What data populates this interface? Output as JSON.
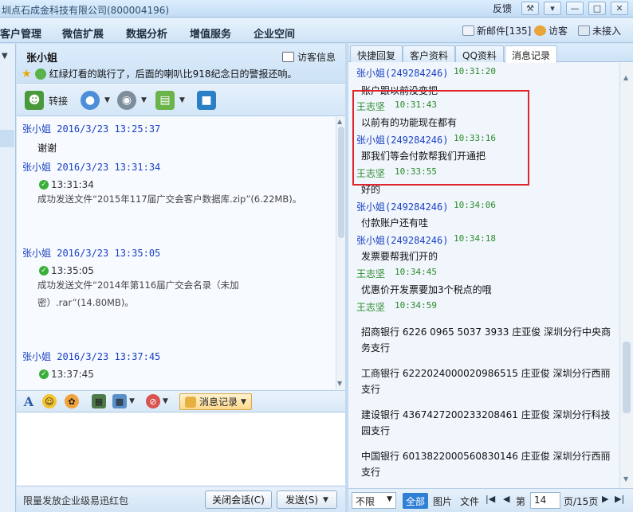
{
  "window": {
    "title": "圳点石成金科技有限公司(800004196)",
    "feedback": "反馈",
    "controls": [
      "wrench-icon",
      "dropdown-icon",
      "minimize-icon",
      "maximize-icon",
      "close-icon"
    ]
  },
  "menubar": {
    "items": [
      "客户管理",
      "微信扩展",
      "数据分析",
      "增值服务",
      "企业空间"
    ],
    "new_mail": "新邮件[135]",
    "visitor": "访客",
    "not_connected": "未接入"
  },
  "chat": {
    "contact_name": "张小姐",
    "visitor_info": "访客信息",
    "status_text": "红绿灯看的跳行了，后面的喇叭比918纪念日的警报还响。",
    "transfer": "转接",
    "messages": [
      {
        "sender": "张小姐 2016/3/23 13:25:37",
        "text": "谢谢"
      },
      {
        "sender": "张小姐 2016/3/23 13:31:34",
        "ok_time": "13:31:34",
        "file": "成功发送文件“2015年117届广交会客户数据库.zip”(6.22MB)。"
      },
      {
        "sender": "张小姐 2016/3/23 13:35:05",
        "ok_time": "13:35:05",
        "file": "成功发送文件“2014年第116届广交会名录（未加密）.rar”(14.80MB)。"
      },
      {
        "sender": "张小姐 2016/3/23 13:37:45",
        "ok_time": "13:37:45"
      }
    ],
    "message_record_button": "消息记录",
    "promo": "限量发放企业级易迅红包",
    "close_session": "关闭会话(C)",
    "send": "发送(S)"
  },
  "right": {
    "tabs": [
      "快捷回复",
      "客户资料",
      "QQ资料",
      "消息记录"
    ],
    "active_tab": "消息记录",
    "history": [
      {
        "sender": "张小姐(249284246)",
        "time": "10:31:20",
        "text": "账户跟以前没变把",
        "green": false
      },
      {
        "sender": "王志坚",
        "time": "10:31:43",
        "text": "以前有的功能现在都有",
        "green": true
      },
      {
        "sender": "张小姐(249284246)",
        "time": "10:33:16",
        "text": "那我们等会付款帮我们开通把",
        "green": false
      },
      {
        "sender": "王志坚",
        "time": "10:33:55",
        "text": "好的",
        "green": true
      },
      {
        "sender": "张小姐(249284246)",
        "time": "10:34:06",
        "text": "付款账户还有哇",
        "green": false
      },
      {
        "sender": "张小姐(249284246)",
        "time": "10:34:18",
        "text": "发票要帮我们开的",
        "green": false
      },
      {
        "sender": "王志坚",
        "time": "10:34:45",
        "text": "优惠价开发票要加3个税点的哦",
        "green": true
      },
      {
        "sender": "王志坚",
        "time": "10:34:59",
        "text": "",
        "green": true
      }
    ],
    "banks": [
      "招商银行 6226 0965 5037 3933 庄亚俊 深圳分行中央商务支行",
      "工商银行 6222024000020986515 庄亚俊 深圳分行西丽支行",
      "建设银行 4367427200233208461 庄亚俊 深圳分行科技园支行",
      "中国银行 6013822000560830146 庄亚俊 深圳分行西丽支行"
    ],
    "pager": {
      "range": "不限",
      "filters": [
        "全部",
        "图片",
        "文件"
      ],
      "active_filter": "全部",
      "page_label": "第",
      "page": "14",
      "page_total": "页/15页"
    }
  }
}
